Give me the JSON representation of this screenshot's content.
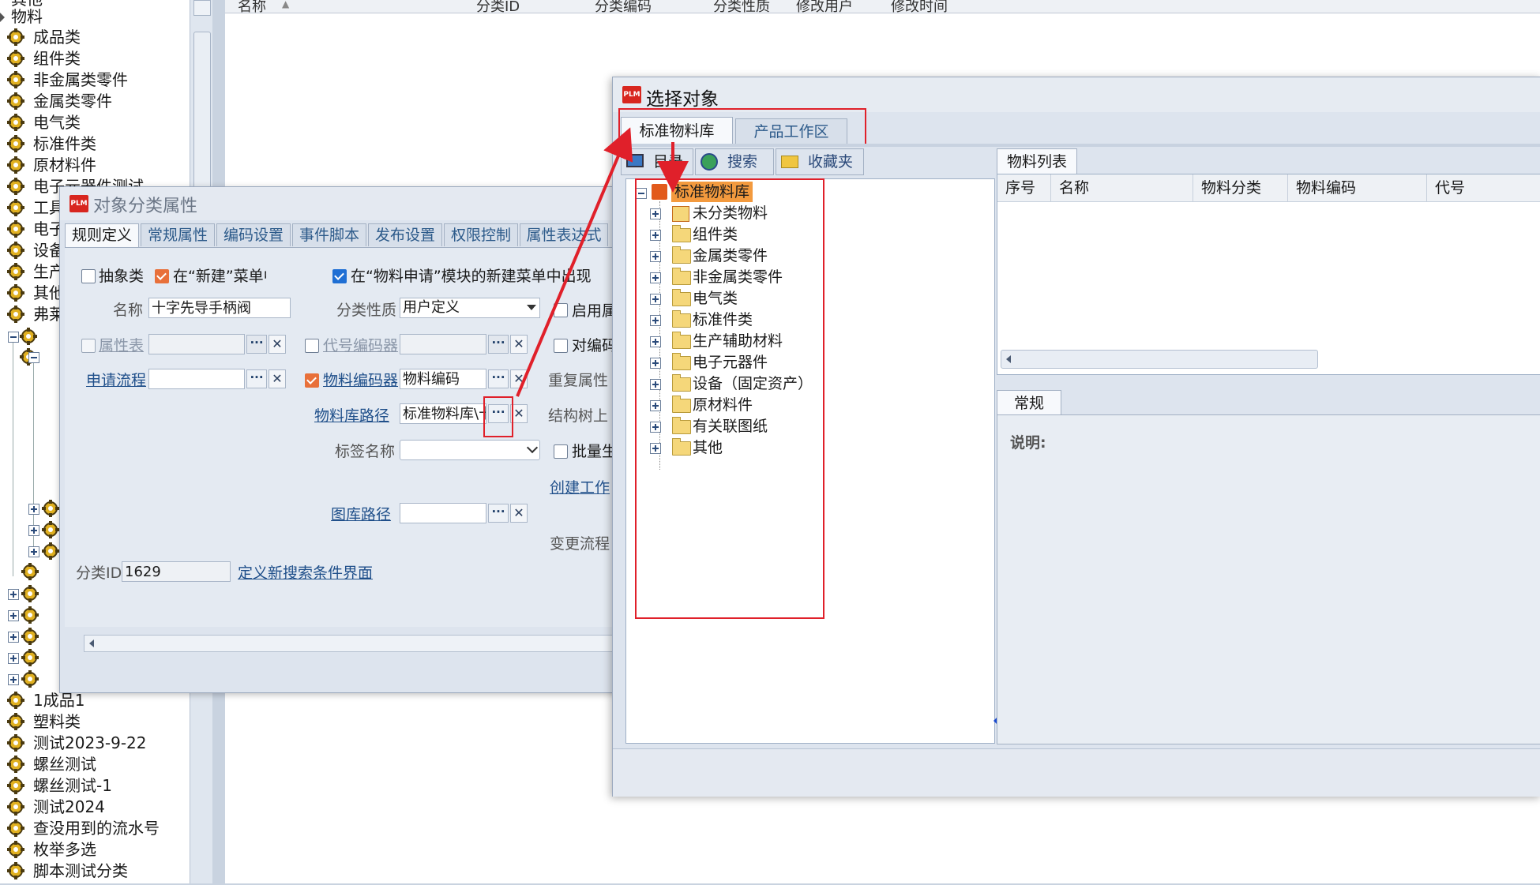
{
  "left_tree": {
    "top_partial": "其他",
    "root": "物料",
    "items": [
      "成品类",
      "组件类",
      "非金属类零件",
      "金属类零件",
      "电气类",
      "标准件类",
      "原材料件",
      "电子元器件测试",
      "工具",
      "电子",
      "设备",
      "生产",
      "其他",
      "弗莱"
    ],
    "bottom_items": [
      "1成品1",
      "塑料类",
      "测试2023-9-22",
      "螺丝测试",
      "螺丝测试-1",
      "测试2024",
      "查没用到的流水号",
      "枚举多选",
      "脚本测试分类"
    ]
  },
  "main_list": {
    "columns": [
      "名称",
      "分类ID",
      "分类编码",
      "分类性质",
      "修改用户",
      "修改时间"
    ],
    "sort_indicator": "▲"
  },
  "prop_dialog": {
    "logo": "PLM",
    "title": "对象分类属性",
    "tabs": [
      "规则定义",
      "常规属性",
      "编码设置",
      "事件脚本",
      "发布设置",
      "权限控制",
      "属性表达式"
    ],
    "abstract_label": "抽象类",
    "new_menu_label": "在“新建”菜单中显示",
    "apply_menu_label": "在“物料申请”模块的新建菜单中出现",
    "name_label": "名称",
    "name_value": "十字先导手柄阀",
    "nature_label": "分类性质",
    "nature_value": "用户定义",
    "enable_label": "启用属",
    "attr_table_label": "属性表",
    "code_encoder_label": "代号编码器",
    "code_check_label": "对编码",
    "apply_flow_label": "申请流程",
    "material_encoder_label": "物料编码器",
    "material_encoder_value": "物料编码",
    "repeat_attr_label": "重复属性",
    "lib_path_label": "物料库路径",
    "lib_path_value": "标准物料库\\十字",
    "struct_tree_label": "结构树上",
    "tag_name_label": "标签名称",
    "batch_label": "批量生",
    "create_work_label": "创建工作",
    "drawing_path_label": "图库路径",
    "change_flow_label": "变更流程",
    "class_id_label": "分类ID",
    "class_id_value": "1629",
    "search_ui_label": "定义新搜索条件界面",
    "dots": "···",
    "x": "✕"
  },
  "select_dialog": {
    "logo": "PLM",
    "title": "选择对象",
    "tabs": [
      "标准物料库",
      "产品工作区"
    ],
    "sub_tabs": [
      "目录",
      "搜索",
      "收藏夹"
    ],
    "tree_root": "标准物料库",
    "tree_items": [
      "未分类物料",
      "组件类",
      "金属类零件",
      "非金属类零件",
      "电气类",
      "标准件类",
      "生产辅助材料",
      "电子元器件",
      "设备（固定资产）",
      "原材料件",
      "有关联图纸",
      "其他"
    ],
    "list_tab": "物料列表",
    "list_columns": [
      "序号",
      "名称",
      "物料分类",
      "物料编码",
      "代号"
    ],
    "general_tab": "常规",
    "desc_label": "说明:"
  }
}
